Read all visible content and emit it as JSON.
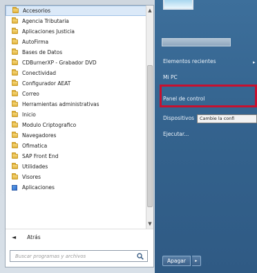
{
  "programs": {
    "items": [
      {
        "label": "Accesorios",
        "icon": "folder-icon",
        "selected": true
      },
      {
        "label": "Agencia Tributaria",
        "icon": "folder-icon"
      },
      {
        "label": "Aplicaciones Justicia",
        "icon": "folder-icon"
      },
      {
        "label": "AutoFirma",
        "icon": "folder-icon"
      },
      {
        "label": "Bases de Datos",
        "icon": "folder-icon"
      },
      {
        "label": "CDBurnerXP - Grabador DVD",
        "icon": "folder-icon"
      },
      {
        "label": "Conectividad",
        "icon": "folder-icon"
      },
      {
        "label": "Configurador AEAT",
        "icon": "folder-icon"
      },
      {
        "label": "Correo",
        "icon": "folder-icon"
      },
      {
        "label": "Herramientas administrativas",
        "icon": "folder-icon"
      },
      {
        "label": "Inicio",
        "icon": "folder-icon"
      },
      {
        "label": "Modulo Criptografico",
        "icon": "folder-icon"
      },
      {
        "label": "Navegadores",
        "icon": "folder-icon"
      },
      {
        "label": "Ofimatica",
        "icon": "folder-icon"
      },
      {
        "label": "SAP Front End",
        "icon": "folder-icon"
      },
      {
        "label": "Utilidades",
        "icon": "folder-icon"
      },
      {
        "label": "Visores",
        "icon": "folder-icon"
      },
      {
        "label": "Aplicaciones",
        "icon": "app-icon"
      }
    ]
  },
  "back": {
    "arrow": "◄",
    "label": "Atrás"
  },
  "search": {
    "placeholder": "Buscar programas y archivos",
    "icon": "search-icon"
  },
  "right_menu": {
    "recent": "Elementos recientes",
    "recent_arrow": "▸",
    "my_pc": "Mi PC",
    "control_panel": "Panel de control",
    "devices": "Dispositivos",
    "run": "Ejecutar..."
  },
  "tooltip": {
    "text": "Cambie la confi"
  },
  "shutdown": {
    "label": "Apagar",
    "arrow": "▸"
  },
  "colors": {
    "right_pane": "#34638e",
    "highlight": "#c8102e",
    "folder": "#e3b43f"
  }
}
